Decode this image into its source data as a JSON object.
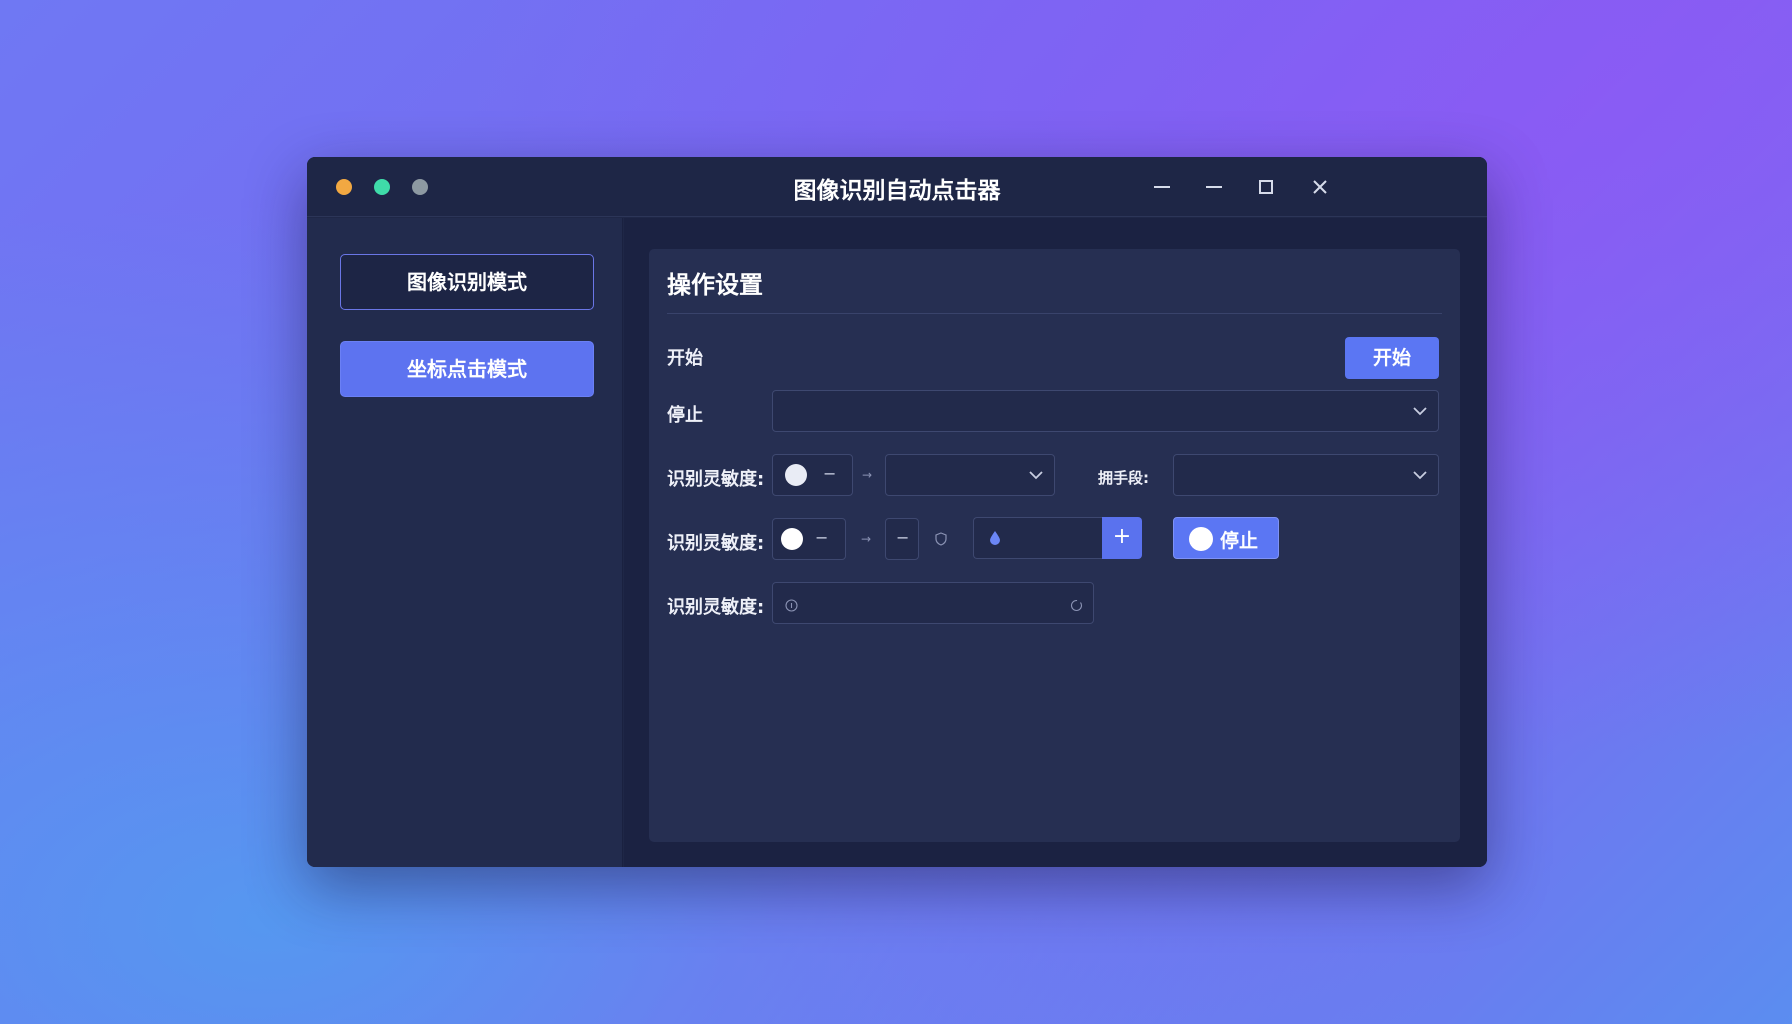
{
  "window": {
    "title": "图像识别自动点击器"
  },
  "sidebar": {
    "items": [
      {
        "label": "图像识别模式"
      },
      {
        "label": "坐标点击模式"
      }
    ]
  },
  "panel": {
    "title": "操作设置",
    "row_start": {
      "label": "开始",
      "button": "开始"
    },
    "row_stop": {
      "label": "停止",
      "select_value": ""
    },
    "row_sensitivity1": {
      "label": "识别灵敏度:",
      "minus": "−",
      "arrow": "→",
      "select_value": "",
      "side_label": "拥手段:",
      "side_select_placeholder": ""
    },
    "row_sensitivity2": {
      "label": "识别灵敏度:",
      "minus": "−",
      "arrow": "→",
      "minus2": "−",
      "plus": "+",
      "stop_button": "停止"
    },
    "row_sensitivity3": {
      "label": "识别灵敏度:",
      "input_placeholder": ""
    }
  },
  "colors": {
    "accent": "#5b76f3",
    "window_bg": "#1f2747",
    "panel_bg": "#262f52"
  },
  "icons": {
    "window_controls": [
      "minimize-icon",
      "minimize-icon",
      "maximize-icon",
      "close-icon"
    ]
  }
}
